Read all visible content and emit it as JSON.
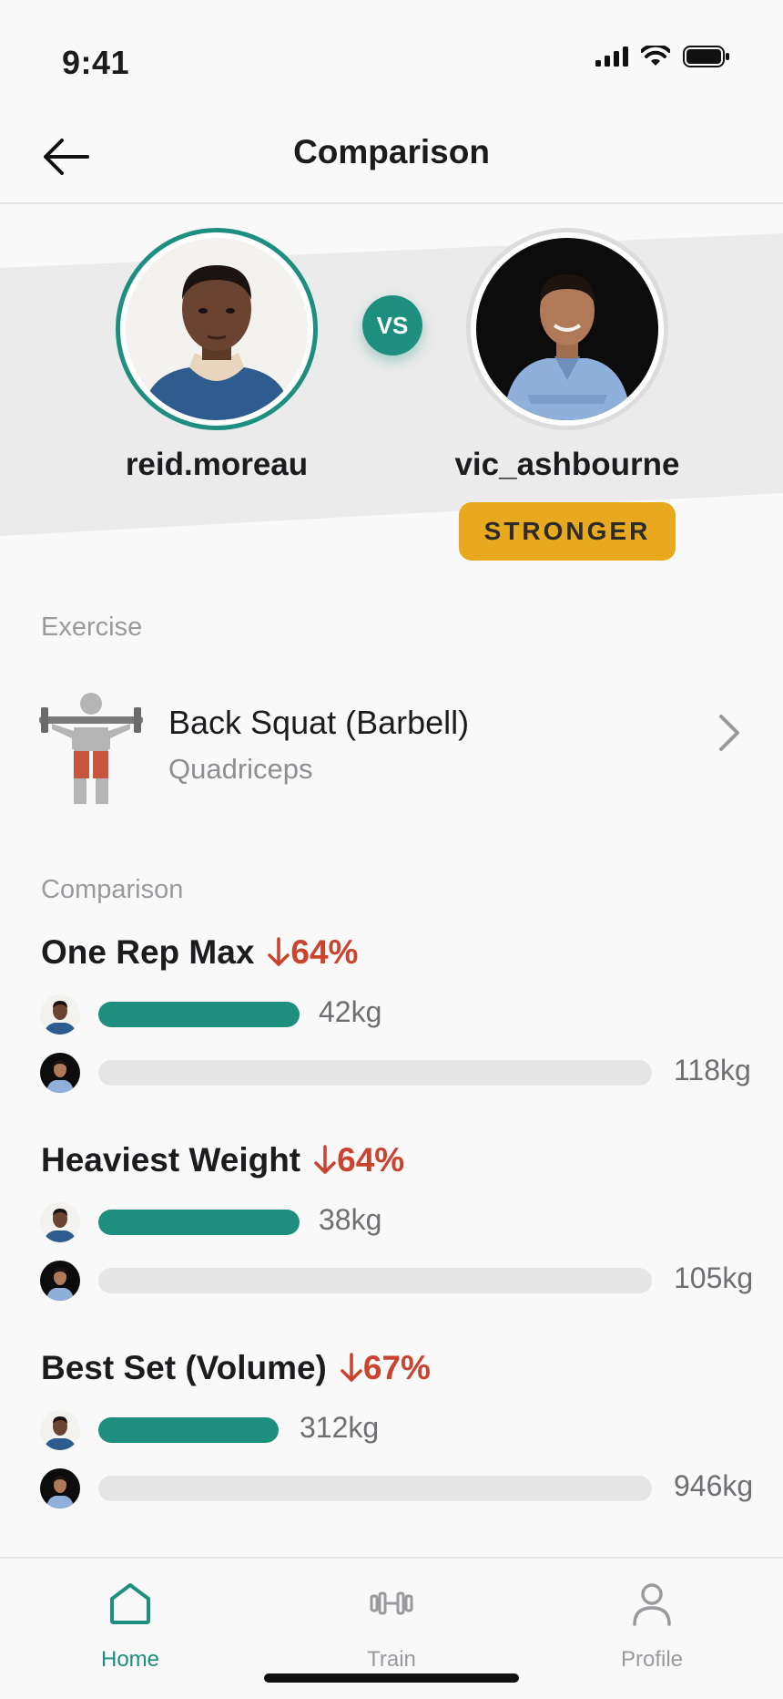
{
  "status_bar": {
    "time": "9:41"
  },
  "nav": {
    "title": "Comparison"
  },
  "users": {
    "left": {
      "name": "reid.moreau"
    },
    "right": {
      "name": "vic_ashbourne"
    },
    "vs_label": "VS",
    "badge": "STRONGER"
  },
  "exercise": {
    "section_label": "Exercise",
    "name": "Back Squat (Barbell)",
    "muscle": "Quadriceps"
  },
  "comparison": {
    "section_label": "Comparison",
    "metrics": [
      {
        "title": "One Rep Max",
        "delta": "64%",
        "left_value": "42kg",
        "right_value": "118kg",
        "left_fraction": 0.36
      },
      {
        "title": "Heaviest Weight",
        "delta": "64%",
        "left_value": "38kg",
        "right_value": "105kg",
        "left_fraction": 0.36
      },
      {
        "title": "Best Set (Volume)",
        "delta": "67%",
        "left_value": "312kg",
        "right_value": "946kg",
        "left_fraction": 0.33
      }
    ]
  },
  "tabs": [
    {
      "label": "Home",
      "icon": "home-icon",
      "active": true
    },
    {
      "label": "Train",
      "icon": "dumbbell-icon",
      "active": false
    },
    {
      "label": "Profile",
      "icon": "person-icon",
      "active": false
    }
  ],
  "colors": {
    "accent": "#1e8f7f",
    "badge": "#e8a91f",
    "decrease": "#c9432f"
  }
}
